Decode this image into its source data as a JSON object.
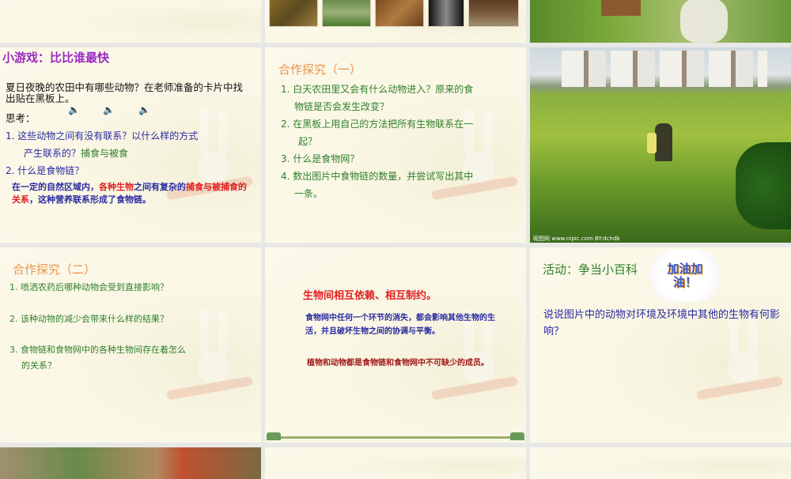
{
  "slides": [
    {
      "id": "top-left"
    },
    {
      "id": "top-middle",
      "thumbnails": [
        "deer",
        "rabbits",
        "lions",
        "owl",
        "bears"
      ]
    },
    {
      "id": "top-right",
      "photo": "dog-and-calf-in-grass"
    },
    {
      "id": "game",
      "title": "小游戏：比比谁最快",
      "intro": "夏日夜晚的农田中有哪些动物？在老师准备的卡片中找出贴在黑板上。",
      "think": "思考：",
      "q1": "1. 这些动物之间有没有联系？以什么样的方式",
      "q1b": "产生联系的？",
      "q1ans": "捕食与被食",
      "q2": "2. 什么是食物链？",
      "def_a": "在一定的自然区域内，",
      "def_b": "各种生物",
      "def_c": "之间有复杂的",
      "def_d": "捕食与被捕食的关系",
      "def_e": "，这种营养联系形成了食物链。"
    },
    {
      "id": "inquiry1",
      "title": "合作探究（一）",
      "items": [
        "1. 白天农田里又会有什么动物进入？原来的食",
        "物链是否会发生改变？",
        "2. 在黑板上用自己的方法把所有生物联系在一",
        "起？",
        "3. 什么是食物网？",
        "4. 数出图片中食物链的数量，并尝试写出其中",
        "一条。"
      ]
    },
    {
      "id": "farm-photo",
      "watermark": "昵图网 www.nipic.com  BY:dchdb"
    },
    {
      "id": "inquiry2",
      "title": "合作探究（二）",
      "items": [
        "1. 喷洒农药后哪种动物会受到直接影响？",
        "2. 该种动物的减少会带来什么样的结果？",
        "3. 食物链和食物网中的各种生物间存在着怎么",
        "的关系？"
      ]
    },
    {
      "id": "conclusion",
      "heading": "生物间相互依赖、相互制约。",
      "p1": "食物网中任何一个环节的消失，都会影响其他生物的生活，并且破坏生物之间的协调与平衡。",
      "p2": "植物和动物都是食物链和食物网中不可缺少的成员。"
    },
    {
      "id": "activity",
      "title": "活动：争当小百科",
      "badge": "加油加油！",
      "body": "说说图片中的动物对环境及环境中其他的生物有何影响？"
    }
  ],
  "colors": {
    "orange_title": "#e8934e",
    "green": "#2f7f2a",
    "blue": "#2a2aa0",
    "red": "#e02020"
  }
}
